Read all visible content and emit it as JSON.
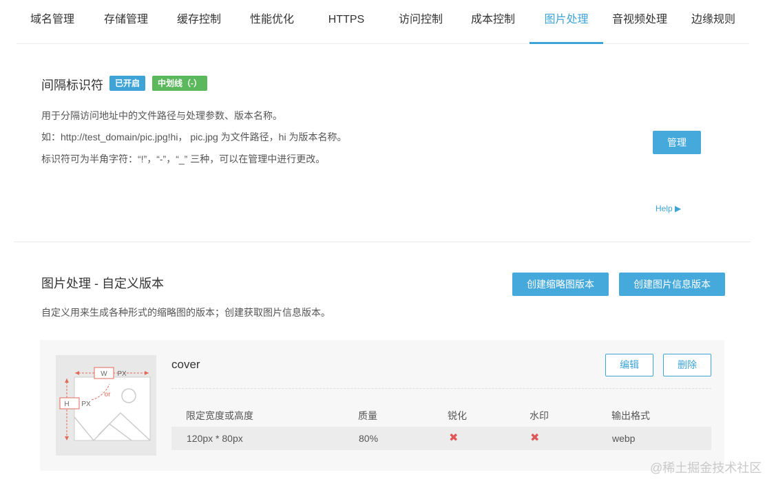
{
  "tabs": [
    {
      "label": "域名管理"
    },
    {
      "label": "存储管理"
    },
    {
      "label": "缓存控制"
    },
    {
      "label": "性能优化"
    },
    {
      "label": "HTTPS"
    },
    {
      "label": "访问控制"
    },
    {
      "label": "成本控制"
    },
    {
      "label": "图片处理"
    },
    {
      "label": "音视频处理"
    },
    {
      "label": "边缘规则"
    }
  ],
  "active_tab": "图片处理",
  "separator": {
    "title": "间隔标识符",
    "status_badge": "已开启",
    "type_badge": "中划线（-）",
    "lines": [
      "用于分隔访问地址中的文件路径与处理参数、版本名称。",
      "如：http://test_domain/pic.jpg!hi， pic.jpg 为文件路径，hi 为版本名称。",
      "标识符可为半角字符：“!”，“-”，“_” 三种，可以在管理中进行更改。"
    ],
    "manage_button": "管理",
    "help_label": "Help ▶"
  },
  "custom_versions": {
    "title": "图片处理 - 自定义版本",
    "description": "自定义用来生成各种形式的缩略图的版本；创建获取图片信息版本。",
    "create_thumbnail_button": "创建缩略图版本",
    "create_info_button": "创建图片信息版本",
    "thumbnail_labels": {
      "w": "W",
      "h": "H",
      "px": "PX",
      "or": "or"
    },
    "version": {
      "name": "cover",
      "edit_button": "编辑",
      "delete_button": "删除",
      "headers": {
        "size": "限定宽度或高度",
        "quality": "质量",
        "sharpen": "锐化",
        "watermark": "水印",
        "format": "输出格式"
      },
      "values": {
        "size": "120px * 80px",
        "quality": "80%",
        "sharpen": "✖",
        "watermark": "✖",
        "format": "webp"
      }
    }
  },
  "watermark_text": "@稀土掘金技术社区",
  "colors": {
    "accent": "#3ea4d8",
    "badge_blue": "#3ea4d8",
    "badge_green": "#5cb85c",
    "cross_red": "#e05757"
  }
}
